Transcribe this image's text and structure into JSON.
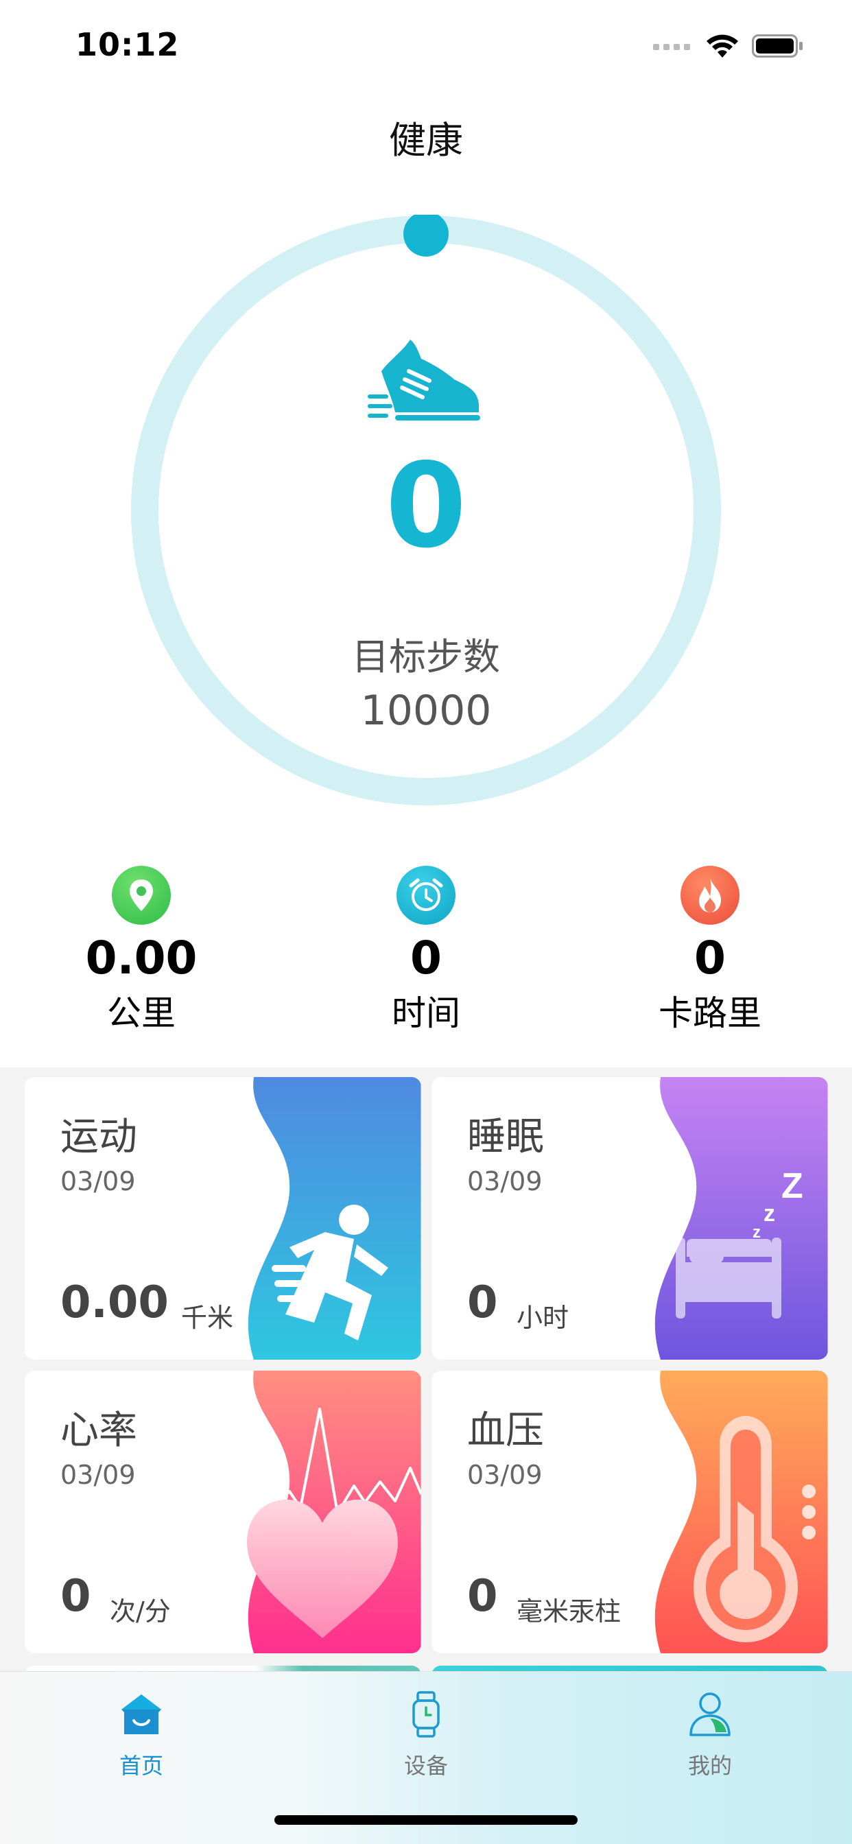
{
  "status_bar": {
    "time": "10:12"
  },
  "nav": {
    "title": "健康"
  },
  "steps": {
    "count": "0",
    "goal_label": "目标步数",
    "goal_value": "10000",
    "progress": 0
  },
  "stats": [
    {
      "value": "0.00",
      "label": "公里",
      "icon": "location-pin-icon",
      "color": "#4cc552"
    },
    {
      "value": "0",
      "label": "时间",
      "icon": "alarm-clock-icon",
      "color": "#14b5d3"
    },
    {
      "value": "0",
      "label": "卡路里",
      "icon": "flame-icon",
      "color": "#f2614a"
    }
  ],
  "cards": [
    {
      "title": "运动",
      "date": "03/09",
      "value": "0.00",
      "unit": "千米",
      "icon": "runner-icon",
      "colors": [
        "#4f8ae0",
        "#2ec7e0"
      ]
    },
    {
      "title": "睡眠",
      "date": "03/09",
      "value": "0",
      "unit": "小时",
      "icon": "bed-icon",
      "colors": [
        "#c683f2",
        "#6d56de"
      ]
    },
    {
      "title": "心率",
      "date": "03/09",
      "value": "0",
      "unit": "次/分",
      "icon": "heart-icon",
      "colors": [
        "#ff8f80",
        "#ff2f8e"
      ]
    },
    {
      "title": "血压",
      "date": "03/09",
      "value": "0",
      "unit": "毫米汞柱",
      "icon": "thermometer-icon",
      "colors": [
        "#ffab5a",
        "#ff5354"
      ]
    }
  ],
  "tabs": [
    {
      "label": "首页",
      "icon": "home-icon",
      "active": true
    },
    {
      "label": "设备",
      "icon": "watch-icon",
      "active": false
    },
    {
      "label": "我的",
      "icon": "user-icon",
      "active": false
    }
  ],
  "colors": {
    "accent": "#15b6d1",
    "ring": "#d3f0f4",
    "active_tab": "#1a8fd0"
  }
}
